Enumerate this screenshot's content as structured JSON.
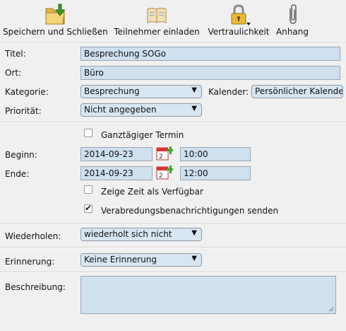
{
  "toolbar": {
    "save_close": "Speichern und Schließen",
    "invite": "Teilnehmer einladen",
    "confidentiality": "Vertraulichkeit",
    "attachment": "Anhang",
    "icons": [
      "save-folder-icon",
      "address-book-icon",
      "lock-icon",
      "paperclip-icon"
    ]
  },
  "form": {
    "title_label": "Titel:",
    "title_value": "Besprechung SOGo",
    "location_label": "Ort:",
    "location_value": "Büro",
    "category_label": "Kategorie:",
    "category_value": "Besprechung",
    "calendar_label": "Kalender:",
    "calendar_value": "Persönlicher Kalender",
    "priority_label": "Priorität:",
    "priority_value": "Nicht angegeben",
    "allday_label": "Ganztägiger Termin",
    "allday_checked": false,
    "start_label": "Beginn:",
    "start_date": "2014-09-23",
    "start_time": "10:00",
    "end_label": "Ende:",
    "end_date": "2014-09-23",
    "end_time": "12:00",
    "show_free_label": "Zeige Zeit als Verfügbar",
    "show_free_checked": false,
    "notify_label": "Verabredungsbenachrichtigungen senden",
    "notify_checked": true,
    "repeat_label": "Wiederholen:",
    "repeat_value": "wiederholt sich nicht",
    "reminder_label": "Erinnerung:",
    "reminder_value": "Keine Erinnerung",
    "description_label": "Beschreibung:",
    "description_value": ""
  },
  "colors": {
    "field_bg": "#cfe0ef",
    "background": "#f0f0f0",
    "folder_icon": "#e9c45a",
    "arrow_icon": "#3a9a2a"
  }
}
